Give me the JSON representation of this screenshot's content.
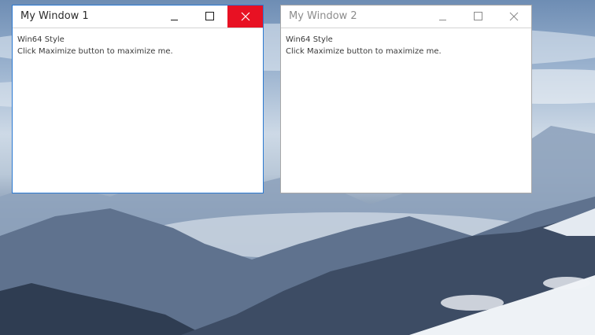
{
  "windows": [
    {
      "title": "My Window 1",
      "state": "active",
      "style_label": "Win64 Style",
      "hint": "Click Maximize button to maximize me.",
      "controls": [
        "minimize-icon",
        "maximize-icon",
        "close-icon"
      ]
    },
    {
      "title": "My Window 2",
      "state": "inactive",
      "style_label": "Win64 Style",
      "hint": "Click Maximize button to maximize me.",
      "controls": [
        "minimize-icon",
        "maximize-icon",
        "close-icon"
      ]
    }
  ],
  "colors": {
    "active_border": "#2b79d1",
    "inactive_border": "#a8a8a8",
    "close_hover": "#e81123",
    "window_bg": "#ffffff"
  },
  "desktop": {
    "wallpaper": "mountain-landscape"
  }
}
